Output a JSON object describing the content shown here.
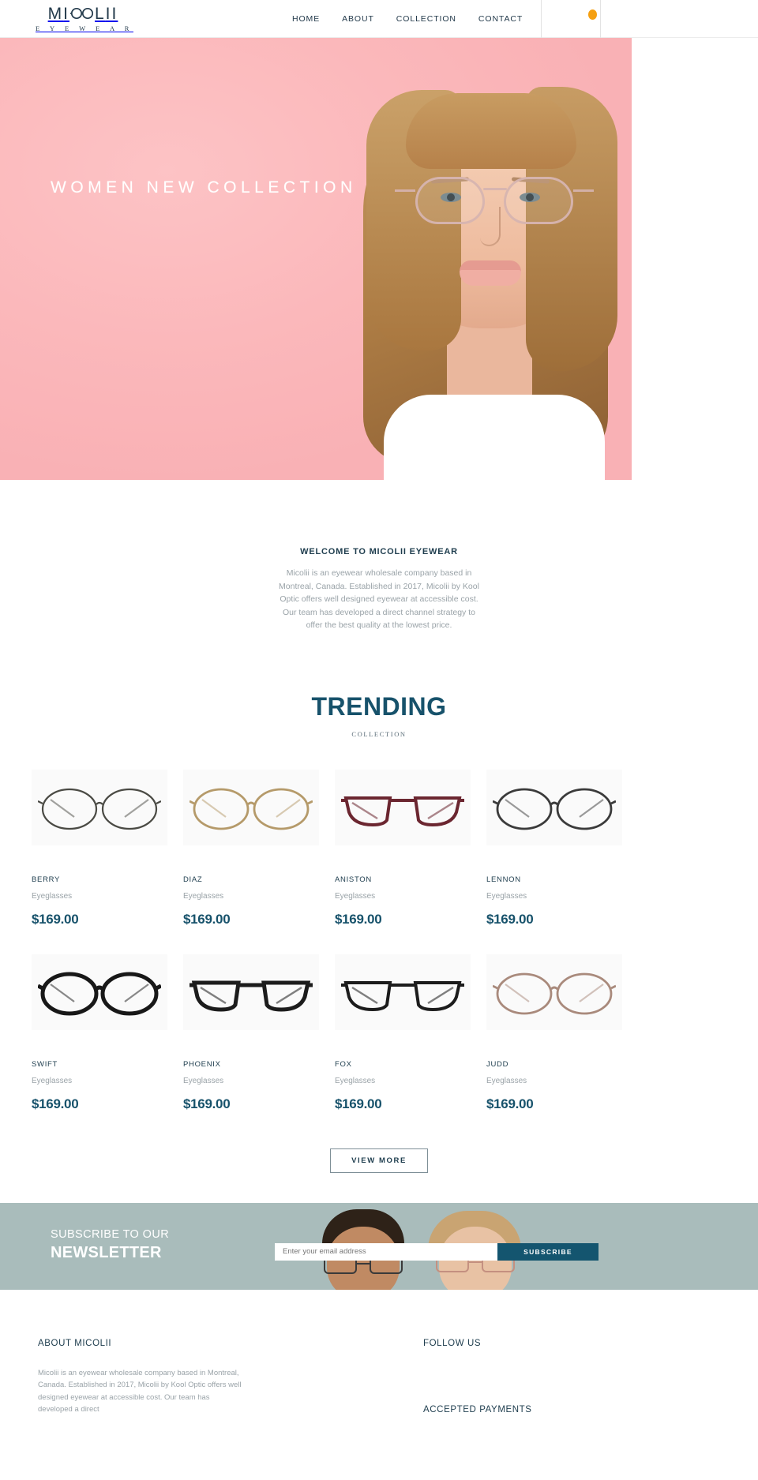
{
  "header": {
    "logo_main": "MICOLII",
    "logo_letters": [
      "M",
      "I",
      "C",
      "O",
      "L",
      "I",
      "I"
    ],
    "logo_sub": "E Y E W E A R",
    "nav": [
      {
        "label": "HOME"
      },
      {
        "label": "ABOUT"
      },
      {
        "label": "COLLECTION"
      },
      {
        "label": "CONTACT"
      }
    ],
    "cart_indicator_icon": "cart-dot-icon",
    "cart_indicator_color": "#f5a011"
  },
  "hero": {
    "title": "WOMEN NEW COLLECTION",
    "background_color": "#fbb9bc",
    "image_alt": "woman-wearing-eyeglasses"
  },
  "welcome": {
    "heading": "WELCOME TO MICOLII EYEWEAR",
    "body": "Micolii is an eyewear wholesale company based in Montreal, Canada. Established in 2017, Micolii by Kool Optic offers well designed eyewear at accessible cost. Our team has developed a direct channel strategy to offer the best quality at the lowest price."
  },
  "trending": {
    "title": "TRENDING",
    "subtitle": "COLLECTION",
    "title_color": "#17526b",
    "products": [
      {
        "name": "BERRY",
        "category": "Eyeglasses",
        "price": "$169.00",
        "frame_style": "round-thin-metal",
        "frame_color": "#4a4a44"
      },
      {
        "name": "DIAZ",
        "category": "Eyeglasses",
        "price": "$169.00",
        "frame_style": "round-gold-metal",
        "frame_color": "#b59a6a"
      },
      {
        "name": "ANISTON",
        "category": "Eyeglasses",
        "price": "$169.00",
        "frame_style": "angular-burgundy",
        "frame_color": "#6b2630"
      },
      {
        "name": "LENNON",
        "category": "Eyeglasses",
        "price": "$169.00",
        "frame_style": "round-dark-metal",
        "frame_color": "#3b3b3b"
      },
      {
        "name": "SWIFT",
        "category": "Eyeglasses",
        "price": "$169.00",
        "frame_style": "round-thick-black",
        "frame_color": "#181818"
      },
      {
        "name": "PHOENIX",
        "category": "Eyeglasses",
        "price": "$169.00",
        "frame_style": "square-thick-black",
        "frame_color": "#1c1c1c"
      },
      {
        "name": "FOX",
        "category": "Eyeglasses",
        "price": "$169.00",
        "frame_style": "angular-black",
        "frame_color": "#1c1c1c"
      },
      {
        "name": "JUDD",
        "category": "Eyeglasses",
        "price": "$169.00",
        "frame_style": "round-rose-metal",
        "frame_color": "#a98a7c"
      }
    ],
    "view_more_label": "VIEW MORE"
  },
  "newsletter": {
    "line1": "SUBSCRIBE TO OUR",
    "line2": "NEWSLETTER",
    "input_placeholder": "Enter your email address",
    "input_value": "",
    "button_label": "SUBSCRIBE",
    "background_color": "#a9bcbb",
    "button_color": "#14556f"
  },
  "footer": {
    "about_heading": "ABOUT MICOLII",
    "about_body": "Micolii is an eyewear wholesale company based in Montreal, Canada. Established in 2017, Micolii by Kool Optic offers well designed eyewear at accessible cost. Our team has developed a direct",
    "follow_heading": "FOLLOW US",
    "payments_heading": "ACCEPTED PAYMENTS"
  }
}
